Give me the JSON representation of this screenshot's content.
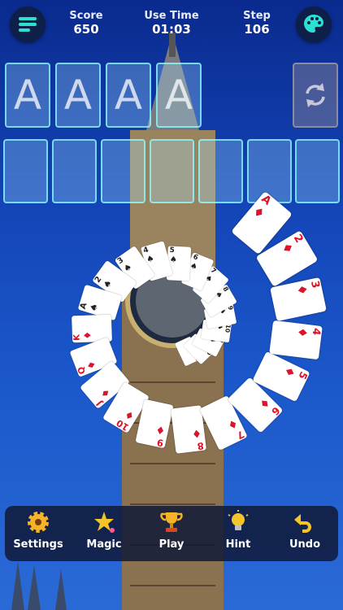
{
  "header": {
    "score_label": "Score",
    "score_value": "650",
    "time_label": "Use Time",
    "time_value": "01:03",
    "step_label": "Step",
    "step_value": "106",
    "menu_icon": "menu-icon",
    "theme_icon": "palette-icon"
  },
  "foundations": [
    "A",
    "A",
    "A",
    "A"
  ],
  "stock_icon": "refresh-icon",
  "spiral": {
    "ranks": [
      "A",
      "2",
      "3",
      "4",
      "5",
      "6",
      "7",
      "8",
      "9",
      "10",
      "J",
      "Q",
      "K",
      "A",
      "2",
      "3",
      "4",
      "5",
      "6",
      "7",
      "8",
      "9",
      "10",
      "J",
      "Q",
      "K"
    ],
    "suits": [
      "♦",
      "♦",
      "♦",
      "♦",
      "♦",
      "♦",
      "♦",
      "♦",
      "♦",
      "♦",
      "♦",
      "♦",
      "♦",
      "♠",
      "♠",
      "♠",
      "♠",
      "♠",
      "♠",
      "♠",
      "♠",
      "♠",
      "♠",
      "♠",
      "♠",
      "♠"
    ]
  },
  "toolbar": {
    "settings_label": "Settings",
    "magic_label": "Magic",
    "play_label": "Play",
    "hint_label": "Hint",
    "undo_label": "Undo"
  },
  "colors": {
    "red": "#d9142b",
    "black": "#222222",
    "accent": "#2ee0d0"
  }
}
